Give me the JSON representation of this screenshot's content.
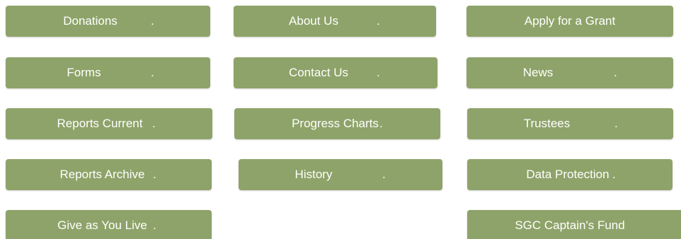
{
  "grid": {
    "buttons": [
      {
        "label": "Donations",
        "dot": "."
      },
      {
        "label": "About Us",
        "dot": "."
      },
      {
        "label": "Apply for a Grant",
        "dot": ""
      },
      {
        "label": "Forms",
        "dot": "."
      },
      {
        "label": "Contact Us",
        "dot": "."
      },
      {
        "label": "News",
        "dot": "."
      },
      {
        "label": "Reports Current",
        "dot": "."
      },
      {
        "label": "Progress Charts",
        "dot": "."
      },
      {
        "label": "Trustees",
        "dot": "."
      },
      {
        "label": "Reports Archive",
        "dot": "."
      },
      {
        "label": "History",
        "dot": "."
      },
      {
        "label": "Data Protection",
        "dot": "."
      },
      {
        "label": "Give as You Live",
        "dot": "."
      },
      {
        "label": "SGC Captain's Fund",
        "dot": ""
      }
    ]
  },
  "colors": {
    "button_bg": "#8ea369",
    "button_text": "#ffffff",
    "page_bg": "#ffffff"
  }
}
